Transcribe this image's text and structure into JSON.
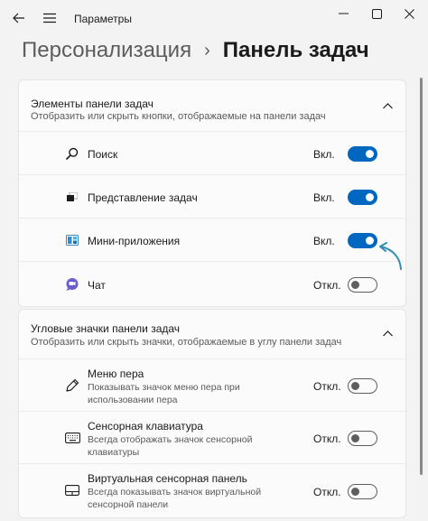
{
  "window": {
    "title": "Параметры",
    "icons": {
      "back": "back-arrow-icon",
      "menu": "hamburger-menu-icon",
      "minimize": "minimize-icon",
      "maximize": "maximize-icon",
      "close": "close-icon"
    }
  },
  "breadcrumb": {
    "parent": "Персонализация",
    "separator": "›",
    "current": "Панель задач"
  },
  "sections": [
    {
      "title": "Элементы панели задач",
      "subtitle": "Отобразить или скрыть кнопки, отображаемые на панели задач",
      "expanded": true,
      "items": [
        {
          "label": "Поиск",
          "state": "Вкл.",
          "on": true,
          "icon": "search-icon"
        },
        {
          "label": "Представление задач",
          "state": "Вкл.",
          "on": true,
          "icon": "task-view-icon"
        },
        {
          "label": "Мини-приложения",
          "state": "Вкл.",
          "on": true,
          "icon": "widgets-icon"
        },
        {
          "label": "Чат",
          "state": "Откл.",
          "on": false,
          "icon": "chat-icon"
        }
      ]
    },
    {
      "title": "Угловые значки панели задач",
      "subtitle": "Отобразить или скрыть значки, отображаемые в углу панели задач",
      "expanded": true,
      "items": [
        {
          "label": "Меню пера",
          "desc": "Показывать значок меню пера при использовании пера",
          "state": "Откл.",
          "on": false,
          "icon": "pen-icon"
        },
        {
          "label": "Сенсорная клавиатура",
          "desc": "Всегда отображать значок сенсорной клавиатуры",
          "state": "Откл.",
          "on": false,
          "icon": "keyboard-icon"
        },
        {
          "label": "Виртуальная сенсорная панель",
          "desc": "Всегда показывать значок виртуальной сенсорной панели",
          "state": "Откл.",
          "on": false,
          "icon": "touchpad-icon"
        }
      ]
    }
  ],
  "colors": {
    "accent": "#0067c0",
    "background": "#f3f3f3",
    "card": "#fbfbfb",
    "hint_arrow": "#2f8fb8"
  }
}
